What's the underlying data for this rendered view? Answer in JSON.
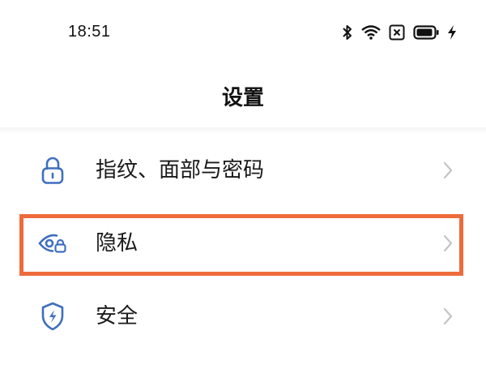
{
  "status_bar": {
    "time": "18:51",
    "icons": [
      "bluetooth-icon",
      "wifi-icon",
      "no-sim-icon",
      "battery-icon",
      "charging-icon"
    ]
  },
  "header": {
    "title": "设置"
  },
  "settings": {
    "items": [
      {
        "label": "指纹、面部与密码",
        "icon": "lock-icon"
      },
      {
        "label": "隐私",
        "icon": "privacy-eye-icon"
      },
      {
        "label": "安全",
        "icon": "shield-icon"
      }
    ]
  },
  "colors": {
    "icon_blue": "#3f6fbf",
    "highlight": "#ee6b3b",
    "chevron": "#c4c4c4",
    "text": "#1a1a1a"
  }
}
